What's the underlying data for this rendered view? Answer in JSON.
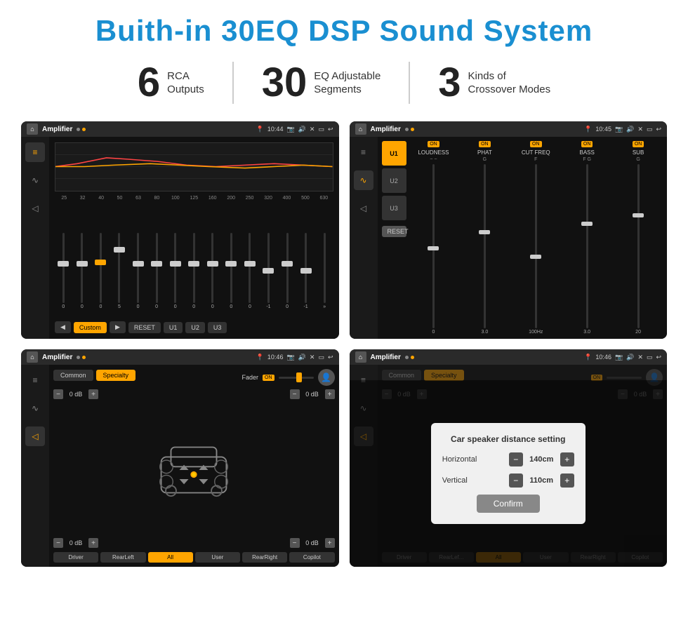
{
  "page": {
    "title": "Buith-in 30EQ DSP Sound System",
    "stats": [
      {
        "number": "6",
        "label": "RCA\nOutputs"
      },
      {
        "number": "30",
        "label": "EQ Adjustable\nSegments"
      },
      {
        "number": "3",
        "label": "Kinds of\nCrossover Modes"
      }
    ]
  },
  "screens": [
    {
      "id": "screen1",
      "title": "Amplifier",
      "time": "10:44",
      "type": "eq",
      "freqs": [
        "25",
        "32",
        "40",
        "50",
        "63",
        "80",
        "100",
        "125",
        "160",
        "200",
        "250",
        "320",
        "400",
        "500",
        "630"
      ],
      "values": [
        "0",
        "0",
        "0",
        "5",
        "0",
        "0",
        "0",
        "0",
        "0",
        "0",
        "0",
        "-1",
        "0",
        "-1"
      ],
      "presets": [
        "Custom",
        "RESET",
        "U1",
        "U2",
        "U3"
      ]
    },
    {
      "id": "screen2",
      "title": "Amplifier",
      "time": "10:45",
      "type": "crossover",
      "uButtons": [
        "U1",
        "U2",
        "U3"
      ],
      "activeU": "U1",
      "columns": [
        "LOUDNESS",
        "PHAT",
        "CUT FREQ",
        "BASS",
        "SUB"
      ],
      "resetLabel": "RESET"
    },
    {
      "id": "screen3",
      "title": "Amplifier",
      "time": "10:46",
      "type": "fader",
      "tabs": [
        "Common",
        "Specialty"
      ],
      "activeTab": "Specialty",
      "faderLabel": "Fader",
      "onLabel": "ON",
      "dbValues": [
        "0 dB",
        "0 dB",
        "0 dB",
        "0 dB"
      ],
      "buttons": [
        "Driver",
        "RearLeft",
        "All",
        "User",
        "RearRight",
        "Copilot"
      ]
    },
    {
      "id": "screen4",
      "title": "Amplifier",
      "time": "10:46",
      "type": "fader-dialog",
      "tabs": [
        "Common",
        "Specialty"
      ],
      "dialog": {
        "title": "Car speaker distance setting",
        "horizontal_label": "Horizontal",
        "horizontal_value": "140cm",
        "vertical_label": "Vertical",
        "vertical_value": "110cm",
        "confirm_label": "Confirm"
      },
      "dbValues": [
        "0 dB",
        "0 dB"
      ],
      "buttons": [
        "Driver",
        "RearLef...",
        "All",
        "User",
        "RearRight",
        "Copilot"
      ]
    }
  ],
  "icons": {
    "home": "⌂",
    "eq_icon": "≡",
    "wave_icon": "∿",
    "speaker_icon": "◁",
    "settings_icon": "⚙",
    "pin_icon": "📍",
    "camera_icon": "📷",
    "volume_icon": "🔊",
    "close_icon": "✕",
    "minimize_icon": "—",
    "back_icon": "↩",
    "play_icon": "▶",
    "prev_icon": "◀",
    "next_icon": "▶▶",
    "expand_icon": "»"
  }
}
